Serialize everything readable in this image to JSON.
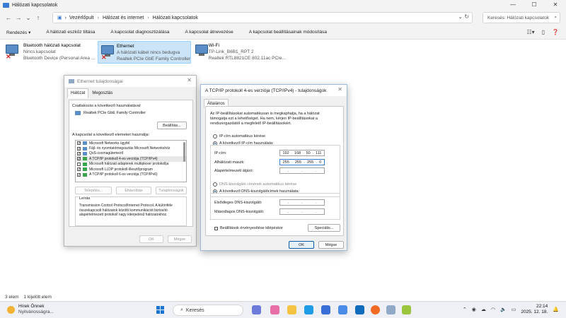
{
  "window": {
    "title": "Hálózati kapcsolatok",
    "controls": [
      "—",
      "☐",
      "✕"
    ]
  },
  "address": {
    "crumbs": [
      "Vezérlőpult",
      "Hálózat és internet",
      "Hálózati kapcsolatok"
    ],
    "search_placeholder": "Keresés: Hálózati kapcsolatok"
  },
  "commandbar": {
    "organize": "Rendezés ▾",
    "disable": "A hálózati eszköz tiltása",
    "diagnose": "A kapcsolat diagnosztizálása",
    "rename": "A kapcsolat átnevezése",
    "change_settings": "A kapcsolat beállításainak módosítása"
  },
  "connections": [
    {
      "name": "Bluetooth hálózati kapcsolat",
      "status": "Nincs kapcsolat",
      "device": "Bluetooth Device (Personal Area ..."
    },
    {
      "name": "Ethernet",
      "status": "A hálózati kábel nincs bedugva",
      "device": "Realtek PCIe GbE Family Controller"
    },
    {
      "name": "Wi-Fi",
      "status": "TP-Link_B6B1_RPT 2",
      "device": "Realtek RTL8821CE 802.11ac PCIe..."
    }
  ],
  "statusbar": {
    "count": "3 elem",
    "selected": "1 kijelölt elem"
  },
  "eth_dialog": {
    "title": "Ethernet tulajdonságai",
    "tabs": [
      "Hálózat",
      "Megosztás"
    ],
    "connect_using": "Csatlakozás a következő használatával:",
    "adapter": "Realtek PCIe GbE Family Controller",
    "configure": "Beállítás...",
    "items_label": "A kapcsolat a következő elemeket használja:",
    "items": [
      {
        "checked": true,
        "label": "Microsoft Networks ügyfél"
      },
      {
        "checked": true,
        "label": "Fájl- és nyomtatómegosztás Microsoft Networkshöz"
      },
      {
        "checked": true,
        "label": "QoS-csomagütemező"
      },
      {
        "checked": true,
        "label": "A TCP/IP protokoll 4-es verziója (TCP/IPv4)"
      },
      {
        "checked": false,
        "label": "Microsoft hálózati adapterek multiplexer protokollja"
      },
      {
        "checked": true,
        "label": "Microsoft LLDP protokoll-illesztőprogram"
      },
      {
        "checked": true,
        "label": "A TCP/IP protokoll 6-os verziója (TCP/IPv6)"
      }
    ],
    "install": "Telepítés...",
    "uninstall": "Eltávolítás",
    "properties": "Tulajdonságok",
    "desc_caption": "Leírás",
    "desc_text": "Transmission Control Protocol/Internet Protocol. A különféle összekapcsolt hálózatok közötti kommunikációt biztosító alapértelmezett protokoll nagy kiterjedésű hálózatokhoz.",
    "ok": "OK",
    "cancel": "Mégse"
  },
  "ipv4_dialog": {
    "title": "A TCP/IP protokoll 4-es verziója (TCP/IPv4) - tulajdonságok",
    "tab": "Általános",
    "intro": "Az IP-beállításokat automatikusan is megkaphatja, ha a hálózat támogatja ezt a lehetőséget. Ha nem, kérjen IP-beállításokat a rendszergazdától a megfelelő IP-beállításokért.",
    "auto_ip": "IP-cím automatikus kérése",
    "manual_ip": "A következő IP-cím használata:",
    "ip_label": "IP-cím:",
    "ip": [
      "192",
      "168",
      "50",
      "111"
    ],
    "mask_label": "Alhálózati maszk:",
    "mask": [
      "255",
      "255",
      "255",
      "0"
    ],
    "gateway_label": "Alapértelmezett átjáró:",
    "auto_dns": "DNS-kiszolgáló címének automatikus kérése",
    "manual_dns": "A következő DNS-kiszolgálócímek használata:",
    "dns1_label": "Elsődleges DNS-kiszolgáló:",
    "dns2_label": "Másodlagos DNS-kiszolgáló:",
    "validate": "Beállítások érvényesítése kilépéskor",
    "advanced": "Speciális...",
    "ok": "OK",
    "cancel": "Mégse"
  },
  "taskbar": {
    "news_title": "Hírek Önnek",
    "news_sub": "Nyilvánosságra...",
    "search": "Keresés",
    "time": "22:14",
    "date": "2025. 12. 18."
  }
}
